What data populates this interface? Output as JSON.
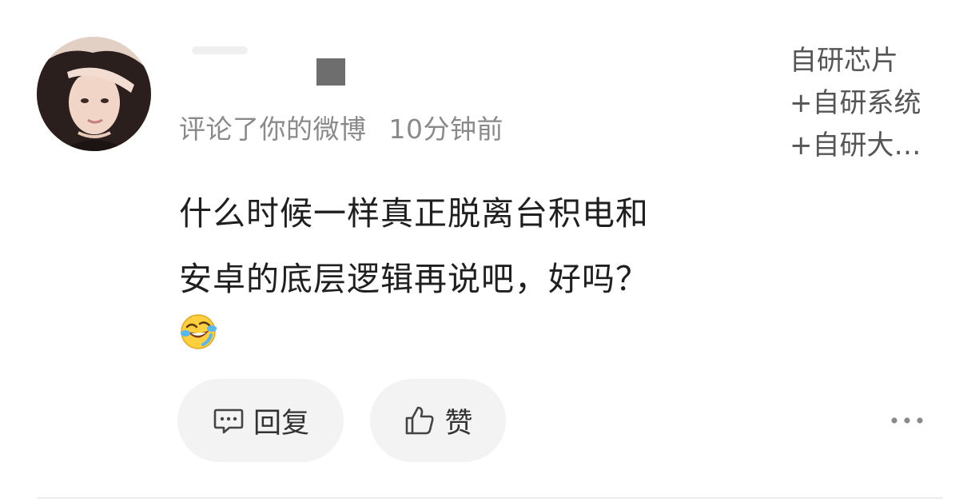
{
  "notification": {
    "action_text": "评论了你的微博",
    "timestamp": "10分钟前",
    "referenced_post_preview": [
      "自研芯片",
      "+自研系统",
      "+自研大…"
    ],
    "comment_lines": [
      "什么时候一样真正脱离台积电和",
      "安卓的底层逻辑再说吧，好吗？"
    ],
    "emoji": "laughing-crying-emoji"
  },
  "actions": {
    "reply_label": "回复",
    "like_label": "赞",
    "reply_icon": "comment-bubble-icon",
    "like_icon": "thumbs-up-icon",
    "more_icon": "more-dots-icon"
  },
  "colors": {
    "pill_bg": "#f3f3f3",
    "meta_text": "#8a8a8a",
    "body_text": "#1f1f1f"
  }
}
